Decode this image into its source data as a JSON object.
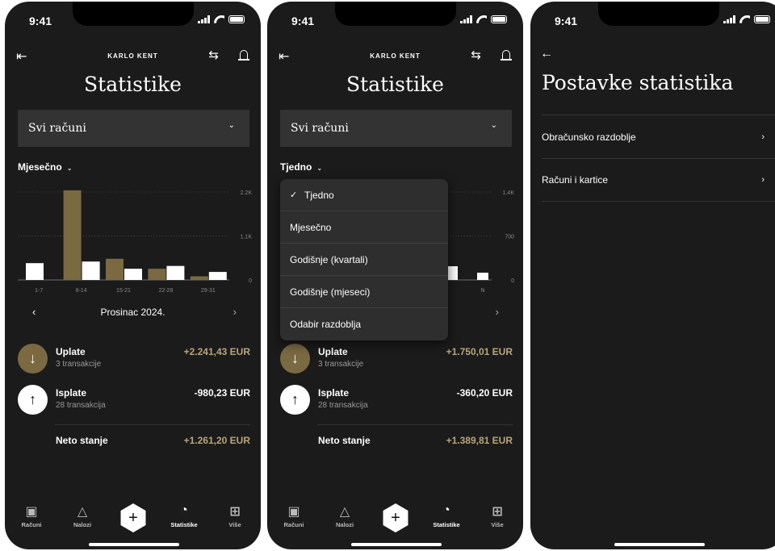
{
  "status": {
    "time": "9:41"
  },
  "header": {
    "user_name": "KARLO KENT",
    "title": "Statistike"
  },
  "account_select": {
    "value": "Svi računi"
  },
  "screen1": {
    "period": "Mjesečno",
    "chart_data": {
      "type": "bar",
      "categories": [
        "1-7",
        "8-14",
        "15-21",
        "22-28",
        "29-31"
      ],
      "series": [
        {
          "color": "#7b6942",
          "values": [
            0,
            2241.43,
            530,
            280,
            90
          ]
        },
        {
          "color": "#ffffff",
          "values": [
            420,
            460,
            280,
            350,
            200
          ]
        }
      ],
      "ylim": [
        0,
        2200
      ],
      "yticks": [
        "2.2K",
        "1.1K",
        "0"
      ]
    },
    "month_label": "Prosinac 2024.",
    "income": {
      "title": "Uplate",
      "count": "3 transakcije",
      "amount": "+2.241,43 EUR"
    },
    "expense": {
      "title": "Isplate",
      "count": "28 transakcija",
      "amount": "-980,23 EUR"
    },
    "net": {
      "label": "Neto stanje",
      "amount": "+1.261,20 EUR"
    }
  },
  "screen2": {
    "period": "Tjedno",
    "yticks": [
      "1.4K",
      "700",
      "0"
    ],
    "visible_category": "N",
    "dropdown_items": [
      "Tjedno",
      "Mjesečno",
      "Godišnje (kvartali)",
      "Godišnje (mjeseci)",
      "Odabir razdoblja"
    ],
    "dropdown_selected": "Tjedno",
    "income": {
      "title": "Uplate",
      "count": "3 transakcije",
      "amount": "+1.750,01 EUR"
    },
    "expense": {
      "title": "Isplate",
      "count": "28 transakcija",
      "amount": "-360,20 EUR"
    },
    "net": {
      "label": "Neto stanje",
      "amount": "+1.389,81 EUR"
    }
  },
  "tabs": [
    {
      "label": "Računi",
      "icon": "wallet-icon"
    },
    {
      "label": "Nalozi",
      "icon": "transfer-icon"
    },
    {
      "label": "Statistike",
      "icon": "pie-chart-icon",
      "active": true
    },
    {
      "label": "Više",
      "icon": "grid-icon"
    }
  ],
  "settings": {
    "title": "Postavke statistika",
    "items": [
      "Obračunsko razdoblje",
      "Računi i kartice"
    ]
  },
  "colors": {
    "background": "#1b1b1b",
    "accent": "#b8a57a",
    "income_bar": "#7b6942"
  }
}
